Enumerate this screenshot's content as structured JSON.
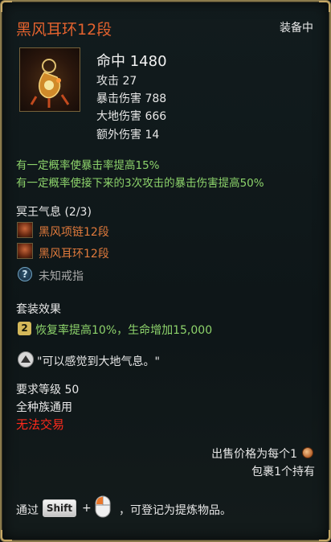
{
  "item": {
    "name": "黑风耳环12段",
    "equipped_label": "装备中",
    "icon": "earring-icon",
    "stats": {
      "main": "命中 1480",
      "lines": [
        "攻击 27",
        "暴击伤害 788",
        "大地伤害 666",
        "额外伤害 14"
      ]
    },
    "effects": [
      "有一定概率使暴击率提高15%",
      "有一定概率使接下来的3次攻击的暴击伤害提高50%"
    ]
  },
  "set": {
    "name": "冥王气息 (2/3)",
    "pieces": [
      {
        "name": "黑风项链12段",
        "owned": true
      },
      {
        "name": "黑风耳环12段",
        "owned": true
      },
      {
        "name": "未知戒指",
        "owned": false
      }
    ],
    "bonus_header": "套装效果",
    "bonus_count": "2",
    "bonus_text": "恢复率提高10%，生命增加15,000"
  },
  "flavor": "\"可以感觉到大地气息。\"",
  "requirements": {
    "level": "要求等级 50",
    "race": "全种族通用",
    "trade": "无法交易"
  },
  "footer": {
    "sell_price": "出售价格为每个1",
    "bag": "包裹1个持有",
    "hint_prefix": "通过",
    "shift_key": "Shift",
    "plus": "+",
    "hint_suffix": "，可登记为提炼物品。"
  },
  "colors": {
    "title": "#e3622e",
    "effect_green": "#8dd36b",
    "set_piece_owned": "#e07a3c",
    "set_piece_missing": "#a8a8a8",
    "untradeable": "#ff2a1c",
    "border_gold": "#8b7a4c"
  }
}
